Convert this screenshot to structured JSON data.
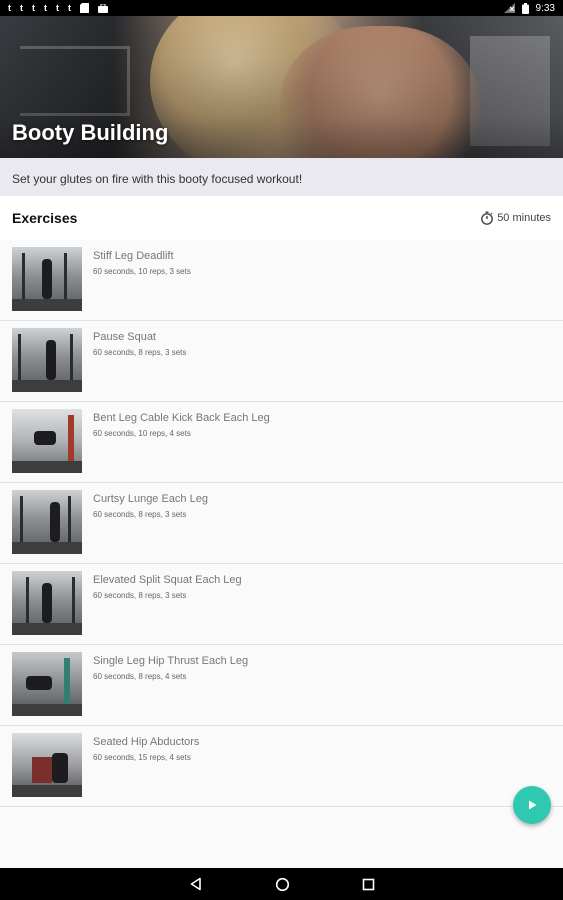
{
  "status_bar": {
    "notification_icons": [
      "t",
      "t",
      "t",
      "t",
      "t",
      "t"
    ],
    "time": "9:33"
  },
  "hero": {
    "title": "Booty Building"
  },
  "description": "Set your glutes on fire with this booty focused workout!",
  "exercises_header": {
    "title": "Exercises",
    "duration": "50 minutes"
  },
  "exercises": [
    {
      "name": "Stiff Leg Deadlift",
      "meta": "60 seconds, 10 reps, 3 sets"
    },
    {
      "name": "Pause Squat",
      "meta": "60 seconds, 8 reps, 3 sets"
    },
    {
      "name": "Bent Leg Cable Kick Back Each Leg",
      "meta": "60 seconds, 10 reps, 4 sets"
    },
    {
      "name": "Curtsy Lunge Each Leg",
      "meta": "60 seconds, 8 reps, 3 sets"
    },
    {
      "name": "Elevated Split Squat Each Leg",
      "meta": "60 seconds, 8 reps, 3 sets"
    },
    {
      "name": "Single Leg Hip Thrust Each Leg",
      "meta": "60 seconds, 8 reps, 4 sets"
    },
    {
      "name": "Seated Hip Abductors",
      "meta": "60 seconds, 15 reps, 4 sets"
    }
  ],
  "colors": {
    "accent": "#2ec9b0",
    "description_bg": "#e9e9ef"
  },
  "icons": {
    "fab": "play-icon",
    "duration": "stopwatch-icon",
    "nav": [
      "back-icon",
      "home-icon",
      "recents-icon"
    ]
  }
}
